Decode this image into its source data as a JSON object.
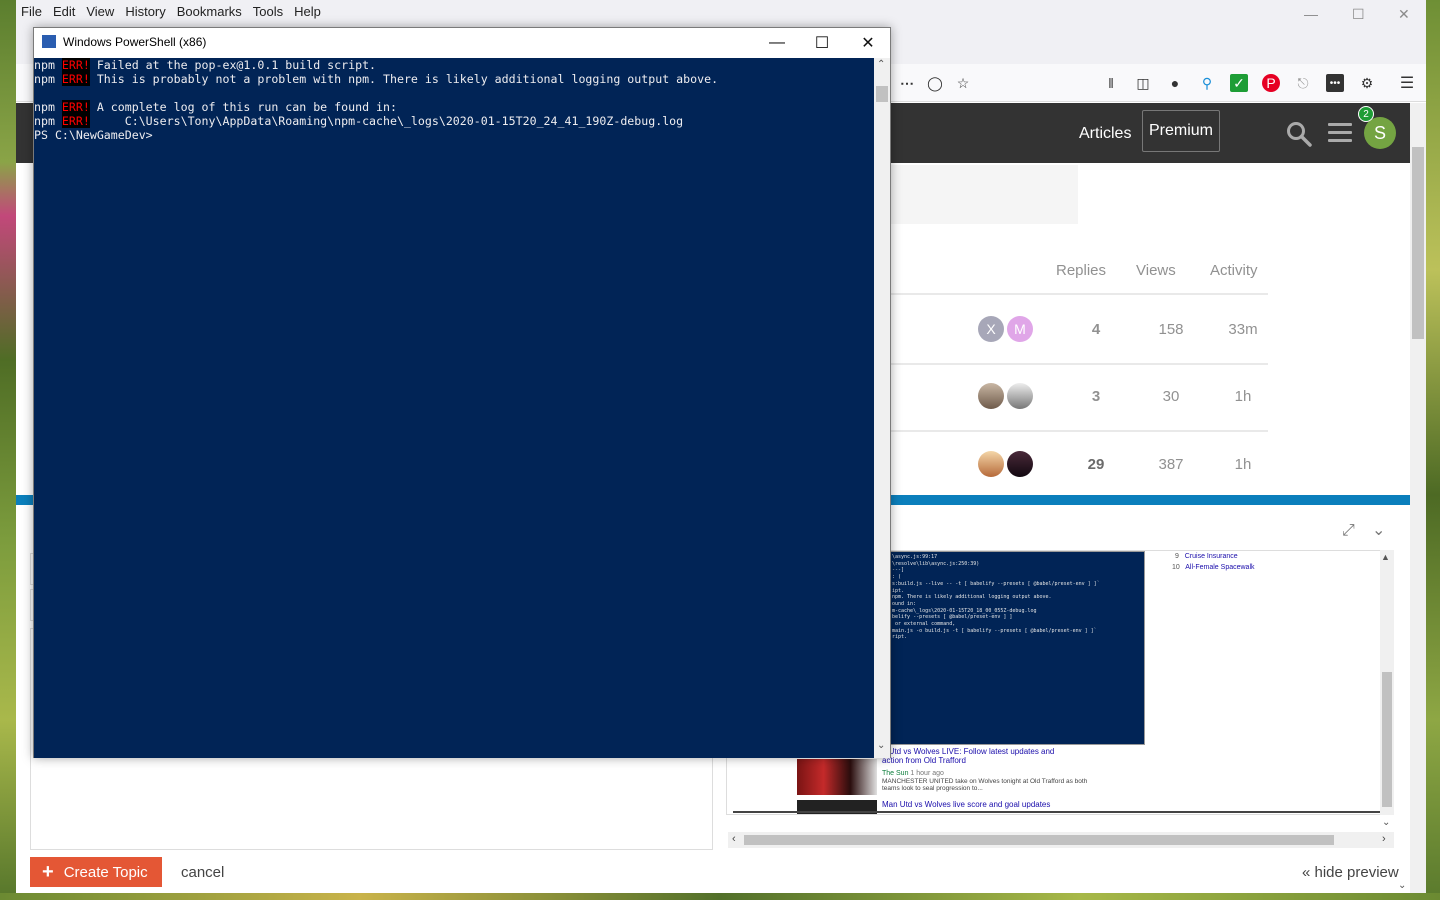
{
  "firefox": {
    "menu": [
      "File",
      "Edit",
      "View",
      "History",
      "Bookmarks",
      "Tools",
      "Help"
    ],
    "window_controls": [
      "minimize",
      "maximize",
      "close"
    ]
  },
  "site": {
    "nav": {
      "articles": "Articles",
      "premium": "Premium"
    },
    "user": {
      "avatar_letter": "S",
      "notification_count": "2"
    }
  },
  "topics": {
    "headers": {
      "replies": "Replies",
      "views": "Views",
      "activity": "Activity"
    },
    "rows": [
      {
        "posters": [
          "X",
          "M"
        ],
        "replies": "4",
        "views": "158",
        "activity": "33m"
      },
      {
        "posters": [
          "",
          ""
        ],
        "replies": "3",
        "views": "30",
        "activity": "1h"
      },
      {
        "posters": [
          "",
          ""
        ],
        "replies": "29",
        "views": "387",
        "activity": "1h"
      }
    ]
  },
  "composer": {
    "create_label": "Create Topic",
    "cancel_label": "cancel",
    "hide_preview_label": "« hide preview",
    "preview": {
      "terminal_lines": [
        "\\async.js:99:17",
        "\\resolve\\lib\\async.js:250:39)",
        "---]",
        ": (",
        "",
        "",
        "",
        "s:build.js --live -- -t [ babelify --presets [ @babel/preset-env ] ]`",
        "",
        "",
        "ipt.",
        "npm. There is likely additional logging output above.",
        "",
        "ound in:",
        "m-cache\\_logs\\2020-01-15T20_18_00_055Z-debug.log",
        "",
        "",
        "",
        "belify --presets [ @babel/preset-env ] ]",
        "",
        " or external command,",
        "",
        "",
        "",
        "main.js -o build.js -t [ babelify --presets [ @babel/preset-env ] ]`",
        "",
        "",
        "ript."
      ],
      "side_list": [
        {
          "num": "9",
          "title": "Cruise Insurance"
        },
        {
          "num": "10",
          "title": "All-Female Spacewalk"
        }
      ],
      "news": [
        {
          "headline": "n Utd vs Wolves LIVE: Follow latest updates and action from Old Trafford",
          "source": "The Sun",
          "time": "1 hour ago",
          "snippet": "MANCHESTER UNITED take on Wolves tonight at Old Trafford as both teams look to seal progression to..."
        },
        {
          "headline": "Man Utd vs Wolves live score and goal updates"
        }
      ]
    }
  },
  "powershell": {
    "title": "Windows PowerShell (x86)",
    "lines": [
      {
        "prefix": "npm",
        "err": "ERR!",
        "text": " Failed at the pop-ex@1.0.1 build script."
      },
      {
        "prefix": "npm",
        "err": "ERR!",
        "text": " This is probably not a problem with npm. There is likely additional logging output above."
      },
      {
        "prefix": "",
        "err": "",
        "text": ""
      },
      {
        "prefix": "npm",
        "err": "ERR!",
        "text": " A complete log of this run can be found in:"
      },
      {
        "prefix": "npm",
        "err": "ERR!",
        "text": "     C:\\Users\\Tony\\AppData\\Roaming\\npm-cache\\_logs\\2020-01-15T20_24_41_190Z-debug.log"
      },
      {
        "prefix": "",
        "err": "",
        "text": "PS C:\\NewGameDev>"
      }
    ]
  },
  "colors": {
    "console_bg": "#012456",
    "site_header": "#333333",
    "accent_blue": "#0b7fbc",
    "create_button": "#e45735"
  }
}
